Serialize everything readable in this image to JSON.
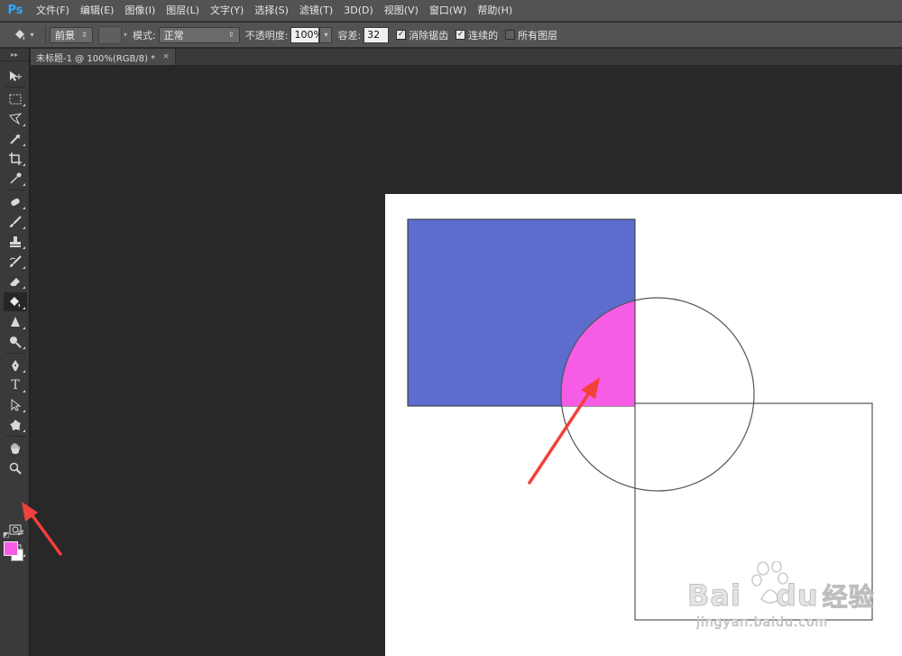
{
  "app": {
    "logo": "Ps"
  },
  "menu": [
    "文件(F)",
    "编辑(E)",
    "图像(I)",
    "图层(L)",
    "文字(Y)",
    "选择(S)",
    "滤镜(T)",
    "3D(D)",
    "视图(V)",
    "窗口(W)",
    "帮助(H)"
  ],
  "options": {
    "fill_source": "前景",
    "mode_label": "模式:",
    "mode_value": "正常",
    "opacity_label": "不透明度:",
    "opacity_value": "100%",
    "tolerance_label": "容差:",
    "tolerance_value": "32",
    "antialias_label": "消除锯齿",
    "antialias_checked": true,
    "contiguous_label": "连续的",
    "contiguous_checked": true,
    "all_layers_label": "所有图层",
    "all_layers_checked": false
  },
  "document_tab": {
    "title": "未标题-1 @ 100%(RGB/8) *",
    "close": "×"
  },
  "colors": {
    "foreground": "#f75ce6",
    "background": "#ffffff",
    "rect_fill": "#5d6dcd",
    "annotation_arrow": "#f2413a"
  },
  "tools": [
    "move-tool",
    "marquee-tool",
    "lasso-tool",
    "magic-wand-tool",
    "crop-tool",
    "eyedropper-tool",
    "spot-healing-tool",
    "brush-tool",
    "clone-stamp-tool",
    "history-brush-tool",
    "eraser-tool",
    "paint-bucket-tool",
    "blur-tool",
    "dodge-tool",
    "pen-tool",
    "type-tool",
    "path-selection-tool",
    "shape-tool",
    "hand-tool",
    "zoom-tool"
  ],
  "active_tool": "paint-bucket-tool",
  "watermark": {
    "brand": "Bai",
    "brand2": "du",
    "suffix": "经验",
    "url": "jingyan.baidu.com"
  }
}
